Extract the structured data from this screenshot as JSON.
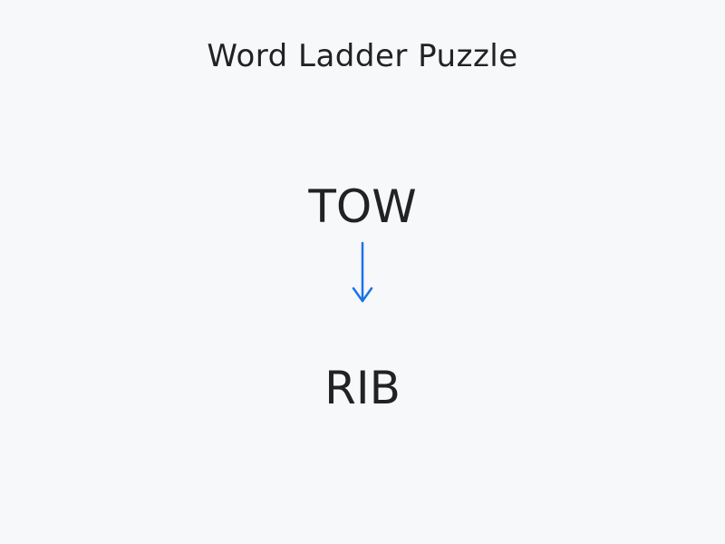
{
  "puzzle": {
    "title": "Word Ladder Puzzle",
    "start_word": "TOW",
    "end_word": "RIB",
    "arrow_icon": "arrow-down-icon",
    "accent_color": "#1a73e8"
  }
}
